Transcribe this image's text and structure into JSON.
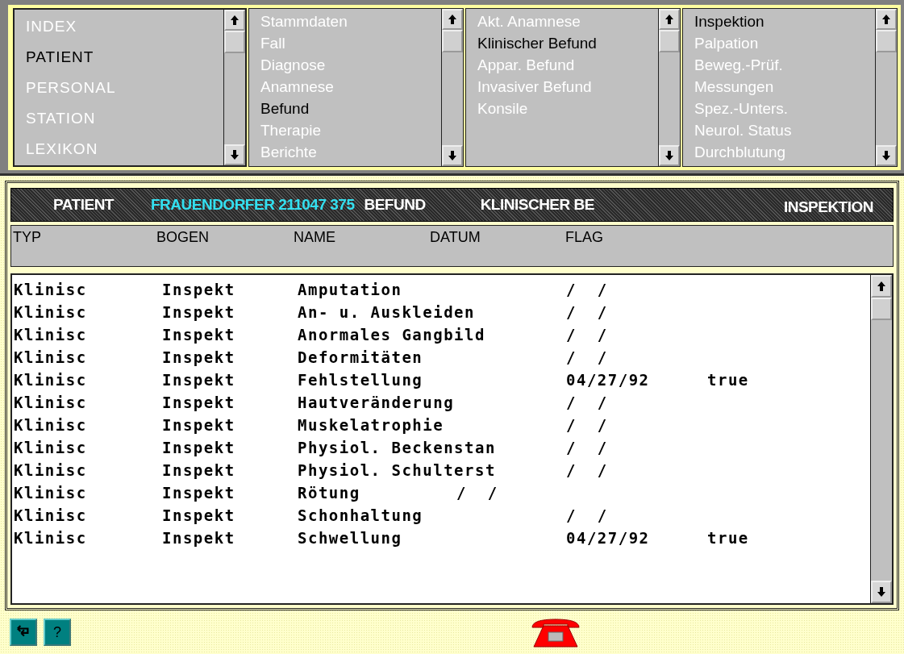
{
  "menus": [
    {
      "items": [
        {
          "label": "INDEX",
          "selected": false
        },
        {
          "label": "PATIENT",
          "selected": true
        },
        {
          "label": "PERSONAL",
          "selected": false
        },
        {
          "label": "STATION",
          "selected": false
        },
        {
          "label": "LEXIKON",
          "selected": false
        }
      ]
    },
    {
      "items": [
        {
          "label": "Stammdaten",
          "selected": false
        },
        {
          "label": "Fall",
          "selected": false
        },
        {
          "label": "Diagnose",
          "selected": false
        },
        {
          "label": "Anamnese",
          "selected": false
        },
        {
          "label": "Befund",
          "selected": true
        },
        {
          "label": "Therapie",
          "selected": false
        },
        {
          "label": "Berichte",
          "selected": false
        }
      ]
    },
    {
      "items": [
        {
          "label": "Akt. Anamnese",
          "selected": false
        },
        {
          "label": "Klinischer Befund",
          "selected": true
        },
        {
          "label": "Appar. Befund",
          "selected": false
        },
        {
          "label": "Invasiver Befund",
          "selected": false
        },
        {
          "label": "Konsile",
          "selected": false
        }
      ]
    },
    {
      "items": [
        {
          "label": "Inspektion",
          "selected": true
        },
        {
          "label": "Palpation",
          "selected": false
        },
        {
          "label": "Beweg.-Prüf.",
          "selected": false
        },
        {
          "label": "Messungen",
          "selected": false
        },
        {
          "label": "Spez.-Unters.",
          "selected": false
        },
        {
          "label": "Neurol. Status",
          "selected": false
        },
        {
          "label": "Durchblutung",
          "selected": false
        }
      ]
    }
  ],
  "breadcrumb": [
    {
      "label": "PATIENT",
      "highlighted": false,
      "selected": false
    },
    {
      "label": "FRAUENDORFER 211047 375",
      "highlighted": true,
      "selected": false
    },
    {
      "label": "BEFUND",
      "highlighted": false,
      "selected": false
    },
    {
      "label": "KLINISCHER BE",
      "highlighted": false,
      "selected": false
    },
    {
      "label": "INSPEKTION",
      "highlighted": false,
      "selected": true
    }
  ],
  "table": {
    "columns": [
      "TYP",
      "BOGEN",
      "NAME",
      "DATUM",
      "FLAG"
    ],
    "rows": [
      [
        "Klinisc",
        "Inspekt",
        "Amputation",
        "",
        "/  /",
        ""
      ],
      [
        "Klinisc",
        "Inspekt",
        "An- u. Auskleiden",
        "",
        "/  /",
        ""
      ],
      [
        "Klinisc",
        "Inspekt",
        "Anormales Gangbild",
        "",
        "/  /",
        ""
      ],
      [
        "Klinisc",
        "Inspekt",
        "Deformitäten",
        "",
        "/  /",
        ""
      ],
      [
        "Klinisc",
        "Inspekt",
        "Fehlstellung",
        "",
        "04/27/92",
        "true"
      ],
      [
        "Klinisc",
        "Inspekt",
        "Hautveränderung",
        "",
        "/  /",
        ""
      ],
      [
        "Klinisc",
        "Inspekt",
        "Muskelatrophie",
        "",
        "/  /",
        ""
      ],
      [
        "Klinisc",
        "Inspekt",
        "Physiol. Beckenstan",
        "",
        "/  /",
        ""
      ],
      [
        "Klinisc",
        "Inspekt",
        "Physiol. Schulterst",
        "",
        "/  /",
        ""
      ],
      [
        "Klinisc",
        "Inspekt",
        "Rötung",
        "/  /",
        "",
        ""
      ],
      [
        "Klinisc",
        "Inspekt",
        "Schonhaltung",
        "",
        "/  /",
        ""
      ],
      [
        "Klinisc",
        "Inspekt",
        "Schwellung",
        "",
        "04/27/92",
        "true"
      ]
    ]
  },
  "help_button": "?"
}
